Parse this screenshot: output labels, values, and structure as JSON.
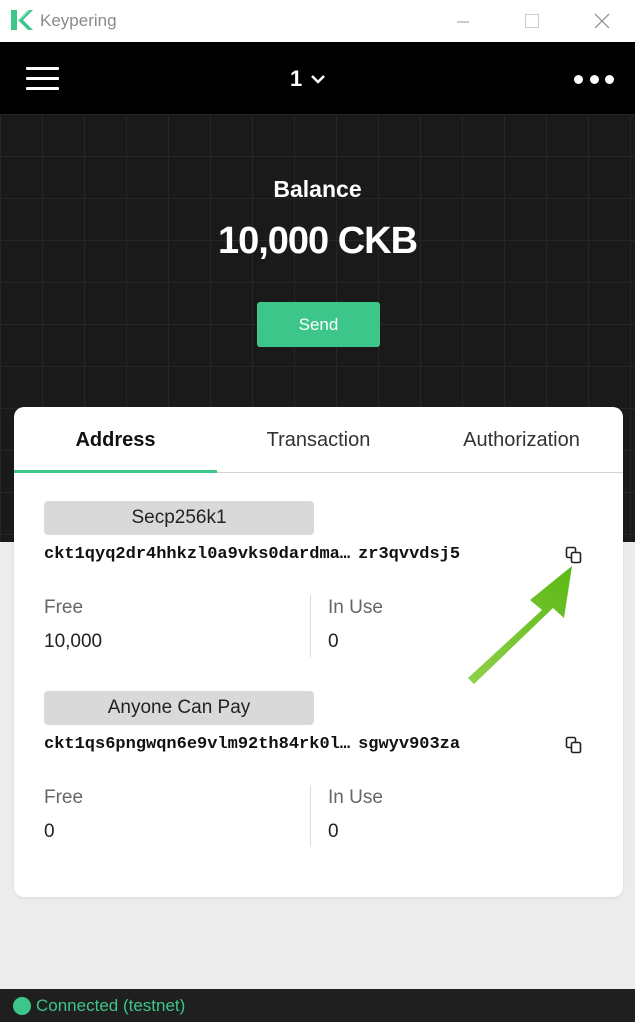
{
  "window": {
    "title": "Keypering"
  },
  "header": {
    "wallet_index": "1"
  },
  "hero": {
    "balance_label": "Balance",
    "balance_value": "10,000 CKB",
    "send_label": "Send"
  },
  "tabs": [
    {
      "label": "Address",
      "active": true
    },
    {
      "label": "Transaction",
      "active": false
    },
    {
      "label": "Authorization",
      "active": false
    }
  ],
  "addresses": [
    {
      "type": "Secp256k1",
      "address_prefix": "ckt1qyq2dr4hhkzl0a9vks0dardma",
      "address_ellipsis": "…",
      "address_suffix": "zr3qvvdsj5",
      "free_label": "Free",
      "free_value": "10,000",
      "inuse_label": "In Use",
      "inuse_value": "0"
    },
    {
      "type": "Anyone Can Pay",
      "address_prefix": "ckt1qs6pngwqn6e9vlm92th84rk0l",
      "address_ellipsis": "…",
      "address_suffix": "sgwyv903za",
      "free_label": "Free",
      "free_value": "0",
      "inuse_label": "In Use",
      "inuse_value": "0"
    }
  ],
  "status": {
    "text": "Connected (testnet)"
  },
  "colors": {
    "accent": "#3cc68a",
    "header_bg": "#000000",
    "arrow": "#6cc21e"
  }
}
